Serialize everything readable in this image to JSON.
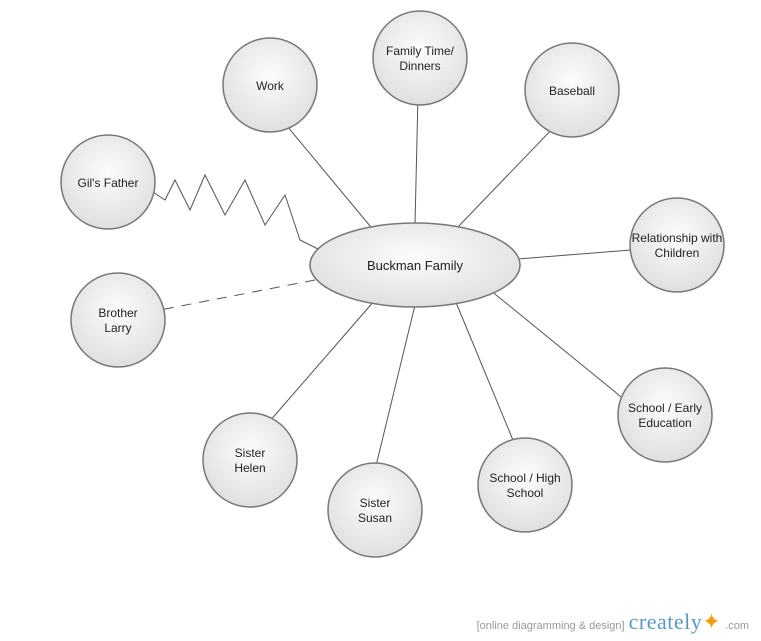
{
  "center": {
    "label": "Buckman Family"
  },
  "nodes": {
    "work": {
      "label": "Work"
    },
    "family_time": {
      "line1": "Family Time/",
      "line2": "Dinners"
    },
    "baseball": {
      "label": "Baseball"
    },
    "gils_father": {
      "label": "Gil's Father"
    },
    "relationship": {
      "line1": "Relationship with",
      "line2": "Children"
    },
    "brother_larry": {
      "line1": "Brother",
      "line2": "Larry"
    },
    "school_early": {
      "line1": "School / Early",
      "line2": "Education"
    },
    "sister_helen": {
      "line1": "Sister",
      "line2": "Helen"
    },
    "sister_susan": {
      "line1": "Sister",
      "line2": "Susan"
    },
    "school_high": {
      "line1": "School / High",
      "line2": "School"
    }
  },
  "footer": {
    "tag": "[online diagramming & design]",
    "brand": "creately",
    "tld": ".com"
  },
  "chart_data": {
    "type": "diagram",
    "title": "Buckman Family concept map",
    "center_node": "Buckman Family",
    "nodes": [
      {
        "id": "work",
        "label": "Work",
        "edge_style": "solid"
      },
      {
        "id": "family_time",
        "label": "Family Time/ Dinners",
        "edge_style": "solid"
      },
      {
        "id": "baseball",
        "label": "Baseball",
        "edge_style": "solid"
      },
      {
        "id": "gils_father",
        "label": "Gil's Father",
        "edge_style": "zigzag"
      },
      {
        "id": "relationship",
        "label": "Relationship with Children",
        "edge_style": "solid"
      },
      {
        "id": "brother_larry",
        "label": "Brother Larry",
        "edge_style": "dashed"
      },
      {
        "id": "school_early",
        "label": "School / Early Education",
        "edge_style": "solid"
      },
      {
        "id": "sister_helen",
        "label": "Sister Helen",
        "edge_style": "solid"
      },
      {
        "id": "sister_susan",
        "label": "Sister Susan",
        "edge_style": "solid"
      },
      {
        "id": "school_high",
        "label": "School / High School",
        "edge_style": "solid"
      }
    ]
  }
}
